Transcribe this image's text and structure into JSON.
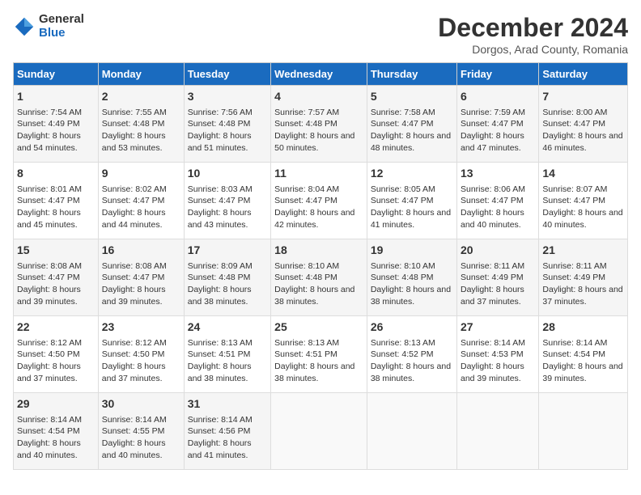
{
  "logo": {
    "general": "General",
    "blue": "Blue"
  },
  "title": "December 2024",
  "subtitle": "Dorgos, Arad County, Romania",
  "days_of_week": [
    "Sunday",
    "Monday",
    "Tuesday",
    "Wednesday",
    "Thursday",
    "Friday",
    "Saturday"
  ],
  "weeks": [
    [
      {
        "day": "1",
        "sunrise": "Sunrise: 7:54 AM",
        "sunset": "Sunset: 4:49 PM",
        "daylight": "Daylight: 8 hours and 54 minutes."
      },
      {
        "day": "2",
        "sunrise": "Sunrise: 7:55 AM",
        "sunset": "Sunset: 4:48 PM",
        "daylight": "Daylight: 8 hours and 53 minutes."
      },
      {
        "day": "3",
        "sunrise": "Sunrise: 7:56 AM",
        "sunset": "Sunset: 4:48 PM",
        "daylight": "Daylight: 8 hours and 51 minutes."
      },
      {
        "day": "4",
        "sunrise": "Sunrise: 7:57 AM",
        "sunset": "Sunset: 4:48 PM",
        "daylight": "Daylight: 8 hours and 50 minutes."
      },
      {
        "day": "5",
        "sunrise": "Sunrise: 7:58 AM",
        "sunset": "Sunset: 4:47 PM",
        "daylight": "Daylight: 8 hours and 48 minutes."
      },
      {
        "day": "6",
        "sunrise": "Sunrise: 7:59 AM",
        "sunset": "Sunset: 4:47 PM",
        "daylight": "Daylight: 8 hours and 47 minutes."
      },
      {
        "day": "7",
        "sunrise": "Sunrise: 8:00 AM",
        "sunset": "Sunset: 4:47 PM",
        "daylight": "Daylight: 8 hours and 46 minutes."
      }
    ],
    [
      {
        "day": "8",
        "sunrise": "Sunrise: 8:01 AM",
        "sunset": "Sunset: 4:47 PM",
        "daylight": "Daylight: 8 hours and 45 minutes."
      },
      {
        "day": "9",
        "sunrise": "Sunrise: 8:02 AM",
        "sunset": "Sunset: 4:47 PM",
        "daylight": "Daylight: 8 hours and 44 minutes."
      },
      {
        "day": "10",
        "sunrise": "Sunrise: 8:03 AM",
        "sunset": "Sunset: 4:47 PM",
        "daylight": "Daylight: 8 hours and 43 minutes."
      },
      {
        "day": "11",
        "sunrise": "Sunrise: 8:04 AM",
        "sunset": "Sunset: 4:47 PM",
        "daylight": "Daylight: 8 hours and 42 minutes."
      },
      {
        "day": "12",
        "sunrise": "Sunrise: 8:05 AM",
        "sunset": "Sunset: 4:47 PM",
        "daylight": "Daylight: 8 hours and 41 minutes."
      },
      {
        "day": "13",
        "sunrise": "Sunrise: 8:06 AM",
        "sunset": "Sunset: 4:47 PM",
        "daylight": "Daylight: 8 hours and 40 minutes."
      },
      {
        "day": "14",
        "sunrise": "Sunrise: 8:07 AM",
        "sunset": "Sunset: 4:47 PM",
        "daylight": "Daylight: 8 hours and 40 minutes."
      }
    ],
    [
      {
        "day": "15",
        "sunrise": "Sunrise: 8:08 AM",
        "sunset": "Sunset: 4:47 PM",
        "daylight": "Daylight: 8 hours and 39 minutes."
      },
      {
        "day": "16",
        "sunrise": "Sunrise: 8:08 AM",
        "sunset": "Sunset: 4:47 PM",
        "daylight": "Daylight: 8 hours and 39 minutes."
      },
      {
        "day": "17",
        "sunrise": "Sunrise: 8:09 AM",
        "sunset": "Sunset: 4:48 PM",
        "daylight": "Daylight: 8 hours and 38 minutes."
      },
      {
        "day": "18",
        "sunrise": "Sunrise: 8:10 AM",
        "sunset": "Sunset: 4:48 PM",
        "daylight": "Daylight: 8 hours and 38 minutes."
      },
      {
        "day": "19",
        "sunrise": "Sunrise: 8:10 AM",
        "sunset": "Sunset: 4:48 PM",
        "daylight": "Daylight: 8 hours and 38 minutes."
      },
      {
        "day": "20",
        "sunrise": "Sunrise: 8:11 AM",
        "sunset": "Sunset: 4:49 PM",
        "daylight": "Daylight: 8 hours and 37 minutes."
      },
      {
        "day": "21",
        "sunrise": "Sunrise: 8:11 AM",
        "sunset": "Sunset: 4:49 PM",
        "daylight": "Daylight: 8 hours and 37 minutes."
      }
    ],
    [
      {
        "day": "22",
        "sunrise": "Sunrise: 8:12 AM",
        "sunset": "Sunset: 4:50 PM",
        "daylight": "Daylight: 8 hours and 37 minutes."
      },
      {
        "day": "23",
        "sunrise": "Sunrise: 8:12 AM",
        "sunset": "Sunset: 4:50 PM",
        "daylight": "Daylight: 8 hours and 37 minutes."
      },
      {
        "day": "24",
        "sunrise": "Sunrise: 8:13 AM",
        "sunset": "Sunset: 4:51 PM",
        "daylight": "Daylight: 8 hours and 38 minutes."
      },
      {
        "day": "25",
        "sunrise": "Sunrise: 8:13 AM",
        "sunset": "Sunset: 4:51 PM",
        "daylight": "Daylight: 8 hours and 38 minutes."
      },
      {
        "day": "26",
        "sunrise": "Sunrise: 8:13 AM",
        "sunset": "Sunset: 4:52 PM",
        "daylight": "Daylight: 8 hours and 38 minutes."
      },
      {
        "day": "27",
        "sunrise": "Sunrise: 8:14 AM",
        "sunset": "Sunset: 4:53 PM",
        "daylight": "Daylight: 8 hours and 39 minutes."
      },
      {
        "day": "28",
        "sunrise": "Sunrise: 8:14 AM",
        "sunset": "Sunset: 4:54 PM",
        "daylight": "Daylight: 8 hours and 39 minutes."
      }
    ],
    [
      {
        "day": "29",
        "sunrise": "Sunrise: 8:14 AM",
        "sunset": "Sunset: 4:54 PM",
        "daylight": "Daylight: 8 hours and 40 minutes."
      },
      {
        "day": "30",
        "sunrise": "Sunrise: 8:14 AM",
        "sunset": "Sunset: 4:55 PM",
        "daylight": "Daylight: 8 hours and 40 minutes."
      },
      {
        "day": "31",
        "sunrise": "Sunrise: 8:14 AM",
        "sunset": "Sunset: 4:56 PM",
        "daylight": "Daylight: 8 hours and 41 minutes."
      },
      null,
      null,
      null,
      null
    ]
  ]
}
